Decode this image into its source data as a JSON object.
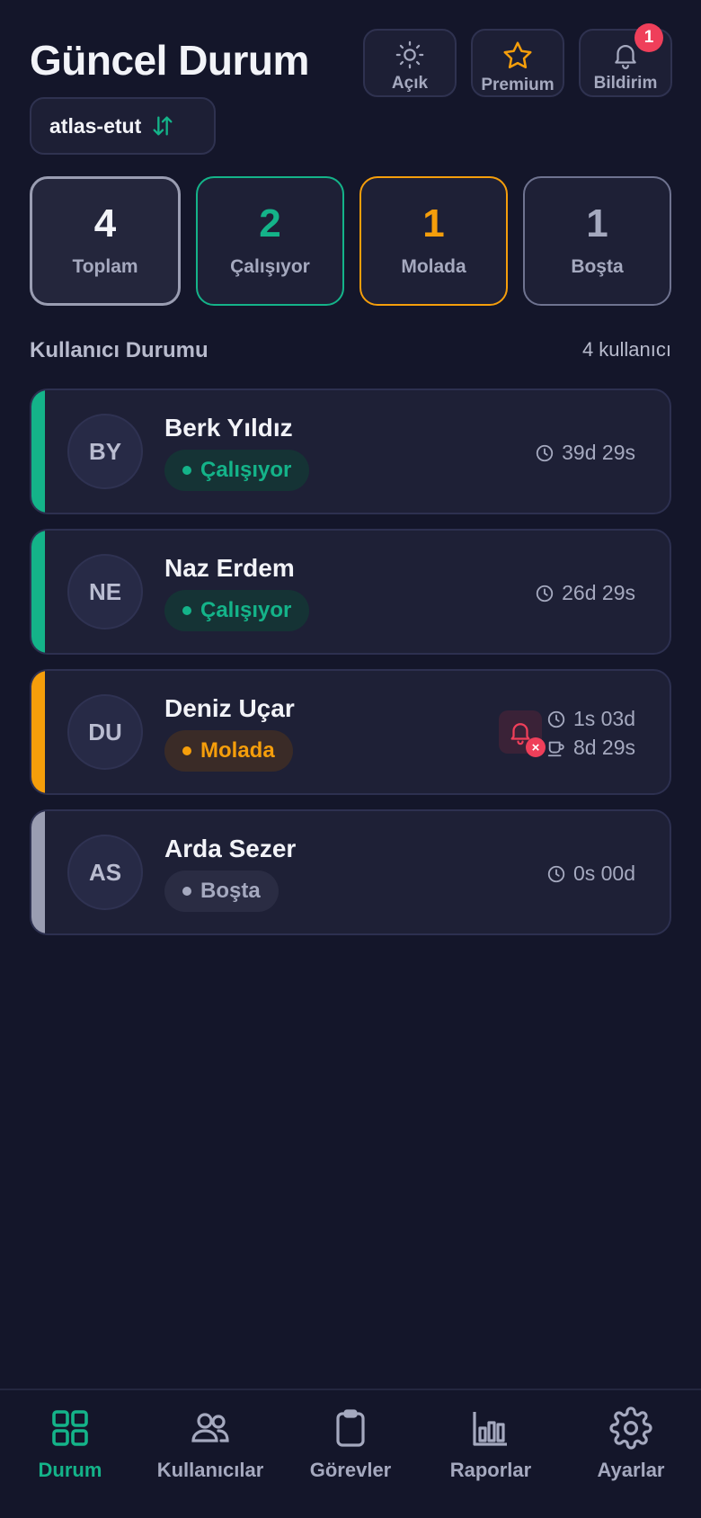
{
  "header": {
    "title": "Güncel Durum",
    "buttons": [
      {
        "label": "Açık",
        "icon": "sun-icon"
      },
      {
        "label": "Premium",
        "icon": "star-icon"
      },
      {
        "label": "Bildirim",
        "icon": "bell-icon",
        "badge": "1"
      }
    ],
    "org": {
      "name": "atlas-etut",
      "icon": "swap-arrows-icon"
    }
  },
  "stats": [
    {
      "value": "4",
      "label": "Toplam",
      "color": "#f2f3f8",
      "border": "#9a9db2"
    },
    {
      "value": "2",
      "label": "Çalışıyor",
      "color": "#14b389",
      "border": "#14b389"
    },
    {
      "value": "1",
      "label": "Molada",
      "color": "#f59e0b",
      "border": "#f59e0b"
    },
    {
      "value": "1",
      "label": "Boşta",
      "color": "#a5a9bf",
      "border": "#6f7390"
    }
  ],
  "section": {
    "title": "Kullanıcı Durumu",
    "count": "4 kullanıcı"
  },
  "users": [
    {
      "initials": "BY",
      "name": "Berk Yıldız",
      "status": "Çalışıyor",
      "accent": "#14b389",
      "pill_bg": "#153335",
      "pill_fg": "#14b389",
      "work_time": "39d 29s"
    },
    {
      "initials": "NE",
      "name": "Naz Erdem",
      "status": "Çalışıyor",
      "accent": "#14b389",
      "pill_bg": "#153335",
      "pill_fg": "#14b389",
      "work_time": "26d 29s"
    },
    {
      "initials": "DU",
      "name": "Deniz Uçar",
      "status": "Molada",
      "accent": "#f59e0b",
      "pill_bg": "#3a2b27",
      "pill_fg": "#f59e0b",
      "work_time": "1s 03d",
      "break_time": "8d 29s",
      "alert": "x"
    },
    {
      "initials": "AS",
      "name": "Arda Sezer",
      "status": "Boşta",
      "accent": "#9a9db2",
      "pill_bg": "#2a2c43",
      "pill_fg": "#a5a9bf",
      "work_time": "0s 00d"
    }
  ],
  "nav": [
    {
      "label": "Durum",
      "icon": "grid-icon",
      "active": true
    },
    {
      "label": "Kullanıcılar",
      "icon": "users-icon"
    },
    {
      "label": "Görevler",
      "icon": "clipboard-icon"
    },
    {
      "label": "Raporlar",
      "icon": "bar-chart-icon"
    },
    {
      "label": "Ayarlar",
      "icon": "gear-icon"
    }
  ],
  "colors": {
    "background": "#14162a",
    "accent": "#14b389",
    "warning": "#f59e0b",
    "danger": "#ef3f5a"
  }
}
